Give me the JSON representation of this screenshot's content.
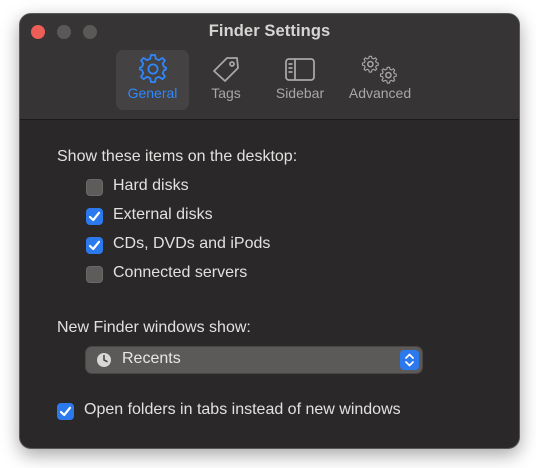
{
  "window": {
    "title": "Finder Settings"
  },
  "tabs": [
    {
      "label": "General",
      "icon": "gear-icon",
      "active": true
    },
    {
      "label": "Tags",
      "icon": "tag-icon",
      "active": false
    },
    {
      "label": "Sidebar",
      "icon": "sidebar-icon",
      "active": false
    },
    {
      "label": "Advanced",
      "icon": "gears-icon",
      "active": false
    }
  ],
  "desktop": {
    "heading": "Show these items on the desktop:",
    "items": [
      {
        "label": "Hard disks",
        "checked": false
      },
      {
        "label": "External disks",
        "checked": true
      },
      {
        "label": "CDs, DVDs and iPods",
        "checked": true
      },
      {
        "label": "Connected servers",
        "checked": false
      }
    ]
  },
  "new_window": {
    "heading": "New Finder windows show:",
    "selected": "Recents",
    "icon": "clock-icon"
  },
  "tabs_option": {
    "label": "Open folders in tabs instead of new windows",
    "checked": true
  },
  "colors": {
    "accent": "#2c79ee",
    "window_bg": "#2a2828",
    "toolbar_bg": "#363434",
    "close_button": "#ee5e58"
  }
}
